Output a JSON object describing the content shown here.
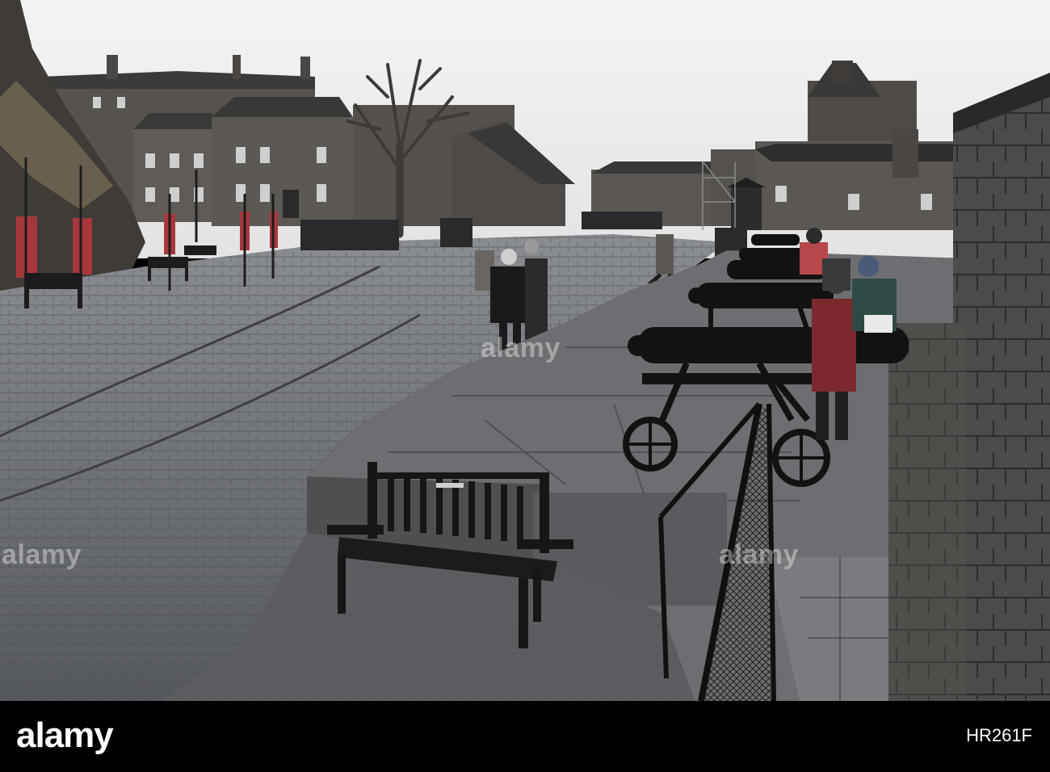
{
  "photo": {
    "scene": "Edinburgh Castle esplanade with cannons and bench",
    "colors": {
      "sky": "#ececec",
      "stone_dark": "#3a3a3c",
      "cobble": "#6b6e73",
      "cannon": "#111111"
    }
  },
  "watermark": {
    "repeat_text": "alamy"
  },
  "footer": {
    "logo_text": "alamy",
    "image_id": "HR261F"
  }
}
